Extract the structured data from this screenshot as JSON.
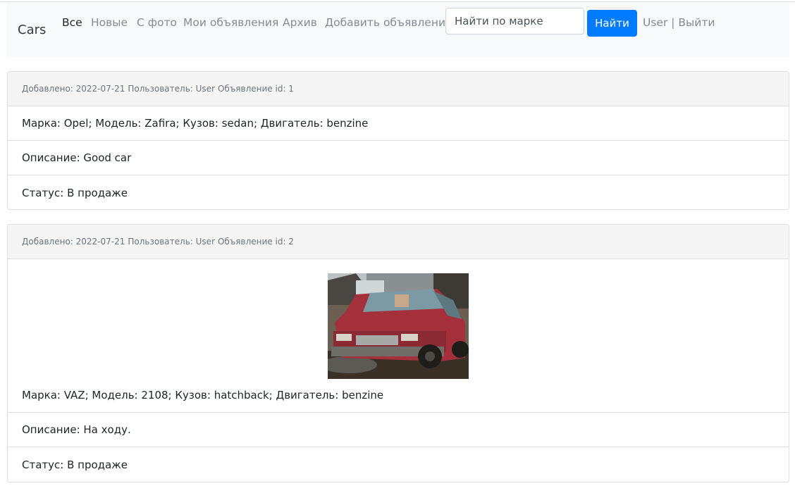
{
  "navbar": {
    "brand": "Cars",
    "links": [
      "Все",
      "Новые",
      "С фото",
      "Мои объявления",
      "Архив",
      "Добавить объявление"
    ],
    "search_placeholder": "Найти по марке",
    "search_button": "Найти",
    "user": "User",
    "separator": " | ",
    "logout": "Выйти"
  },
  "ads": [
    {
      "header": {
        "added": "Добавлено: 2022-07-21",
        "user": "Пользователь: User",
        "id": "Объявление id: 1"
      },
      "details": "Марка: Opel; Модель: Zafira; Кузов: sedan; Двигатель: benzine",
      "description": "Описание: Good car",
      "status": "Статус: В продаже"
    },
    {
      "header": {
        "added": "Добавлено: 2022-07-21",
        "user": "Пользователь: User",
        "id": "Объявление id: 2"
      },
      "details": "Марка: VAZ; Модель: 2108; Кузов: hatchback; Двигатель: benzine",
      "description": "Описание: На ходу.",
      "status": "Статус: В продаже"
    }
  ],
  "colors": {
    "accent": "#007bff",
    "navbar_bg": "#f8f9fa",
    "card_header_bg": "#f5f5f5"
  }
}
